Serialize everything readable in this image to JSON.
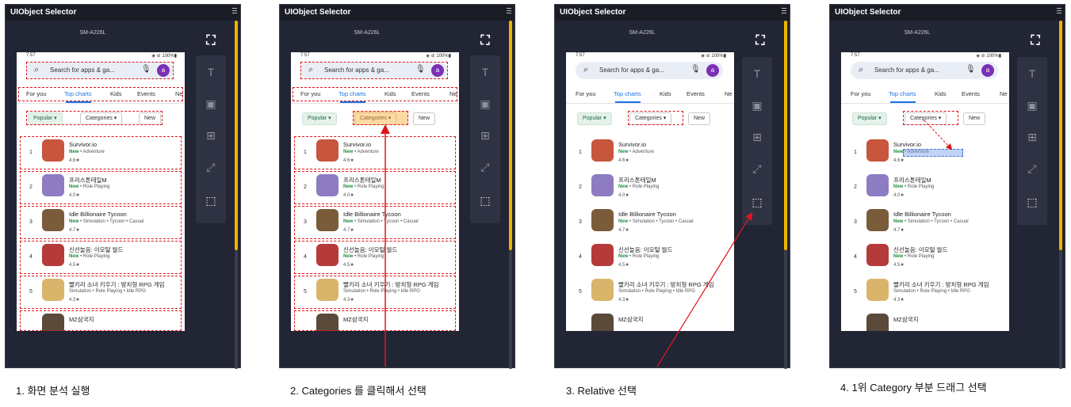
{
  "window_title": "UIObject Selector",
  "device_name": "SM-A226L",
  "status": {
    "time": "7:57",
    "icons": "▣ ▣ ▣ •",
    "right": "◈ ⊘ 100%▮"
  },
  "search": {
    "placeholder": "Search for apps & ga...",
    "avatar": "a"
  },
  "tabs": [
    "For you",
    "Top charts",
    "Kids",
    "Events",
    "Ne"
  ],
  "chips": {
    "popular": "Popular ▾",
    "categories": "Categories ▾",
    "new": "New"
  },
  "apps": [
    {
      "rank": "1",
      "name": "Survivor.io",
      "tag": "New",
      "genres": "• Adventure",
      "rating": "4.6★",
      "color": "#c8553d"
    },
    {
      "rank": "2",
      "name": "프리스톤테일M",
      "tag": "New",
      "genres": "• Role Playing",
      "rating": "4.0★",
      "color": "#8d7cc2"
    },
    {
      "rank": "3",
      "name": "Idle Billionaire Tycoon",
      "tag": "New",
      "genres": "• Simulation • Tycoon • Casual",
      "rating": "4.7★",
      "color": "#7a5b3a"
    },
    {
      "rank": "4",
      "name": "신선놀음: 이모털 월드",
      "tag": "New",
      "genres": "• Role Playing",
      "rating": "4.5★",
      "color": "#b53a3a"
    },
    {
      "rank": "5",
      "name": "빨키리 소녀 키우기 : 방치형 RPG 게임",
      "tag": "",
      "genres": "Simulation • Role Playing • Idle RPG",
      "rating": "4.3★",
      "color": "#d9b56b"
    },
    {
      "rank": "",
      "name": "MZ삼국지",
      "tag": "",
      "genres": "",
      "rating": "",
      "color": "#5a4a3a"
    }
  ],
  "captions": [
    "1. 화면 분석 실행",
    "2. Categories 를 클릭해서 선택",
    "3. Relative 선택",
    "4. 1위 Category 부분 드래그 선택"
  ],
  "colors": {
    "panel": "#222534",
    "accent": "#f0b400",
    "selection": "#e0161c",
    "tab_active": "#1a73e8"
  }
}
